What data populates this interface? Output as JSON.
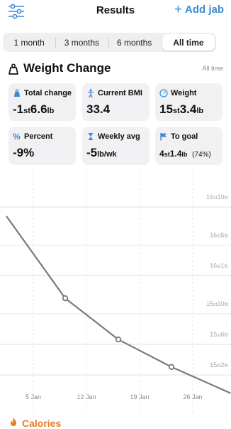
{
  "header": {
    "title": "Results",
    "add_label": "Add jab",
    "filter_icon": "sliders-icon"
  },
  "range_tabs": [
    {
      "label": "1 month",
      "active": false
    },
    {
      "label": "3 months",
      "active": false
    },
    {
      "label": "6 months",
      "active": false
    },
    {
      "label": "All time",
      "active": true
    }
  ],
  "section": {
    "title": "Weight Change",
    "range_label": "All time",
    "icon": "scale-weight-icon"
  },
  "stats": {
    "total_change": {
      "label": "Total change",
      "sign": "-1",
      "unit1": "st",
      "num2": "6.6",
      "unit2": "lb",
      "icon": "weight-bag-icon",
      "color": "#3b8ad6"
    },
    "current_bmi": {
      "label": "Current BMI",
      "value": "33.4",
      "icon": "person-icon",
      "color": "#3b8ad6"
    },
    "weight": {
      "label": "Weight",
      "num1": "15",
      "unit1": "st",
      "num2": "3.4",
      "unit2": "lb",
      "icon": "gauge-icon",
      "color": "#3b8ad6"
    },
    "percent": {
      "label": "Percent",
      "value": "-9%",
      "icon": "percent-icon",
      "color": "#3b8ad6"
    },
    "weekly_avg": {
      "label": "Weekly avg",
      "num": "-5",
      "unit": "lb/wk",
      "icon": "hourglass-icon",
      "color": "#3b8ad6"
    },
    "to_goal": {
      "label": "To goal",
      "num1": "4",
      "unit1": "st",
      "num2": "1.4",
      "unit2": "lb",
      "pct": "(74%)",
      "icon": "flag-icon",
      "color": "#3b8ad6"
    }
  },
  "chart_data": {
    "type": "line",
    "x_ticks": [
      "5 Jan",
      "12 Jan",
      "19 Jan",
      "26 Jan"
    ],
    "y_ticks": [
      {
        "st": "16",
        "lb": "10",
        "value_lb": 234
      },
      {
        "st": "16",
        "lb": "5",
        "value_lb": 229
      },
      {
        "st": "16",
        "lb": "1",
        "value_lb": 225
      },
      {
        "st": "15",
        "lb": "10",
        "value_lb": 220
      },
      {
        "st": "15",
        "lb": "6",
        "value_lb": 216
      },
      {
        "st": "15",
        "lb": "2",
        "value_lb": 212
      }
    ],
    "points": [
      {
        "day": -1,
        "lb": 232.0,
        "marker": false
      },
      {
        "day": 10,
        "lb": 221.3,
        "marker": true
      },
      {
        "day": 20,
        "lb": 215.9,
        "marker": true
      },
      {
        "day": 30,
        "lb": 212.3,
        "marker": true
      },
      {
        "day": 41,
        "lb": 208.9,
        "marker": false
      }
    ],
    "x_tick_days": [
      4,
      14,
      24,
      34
    ],
    "line_color": "#7a7a7a",
    "grid": true
  },
  "next_section": {
    "title": "Calories",
    "icon": "flame-icon"
  }
}
